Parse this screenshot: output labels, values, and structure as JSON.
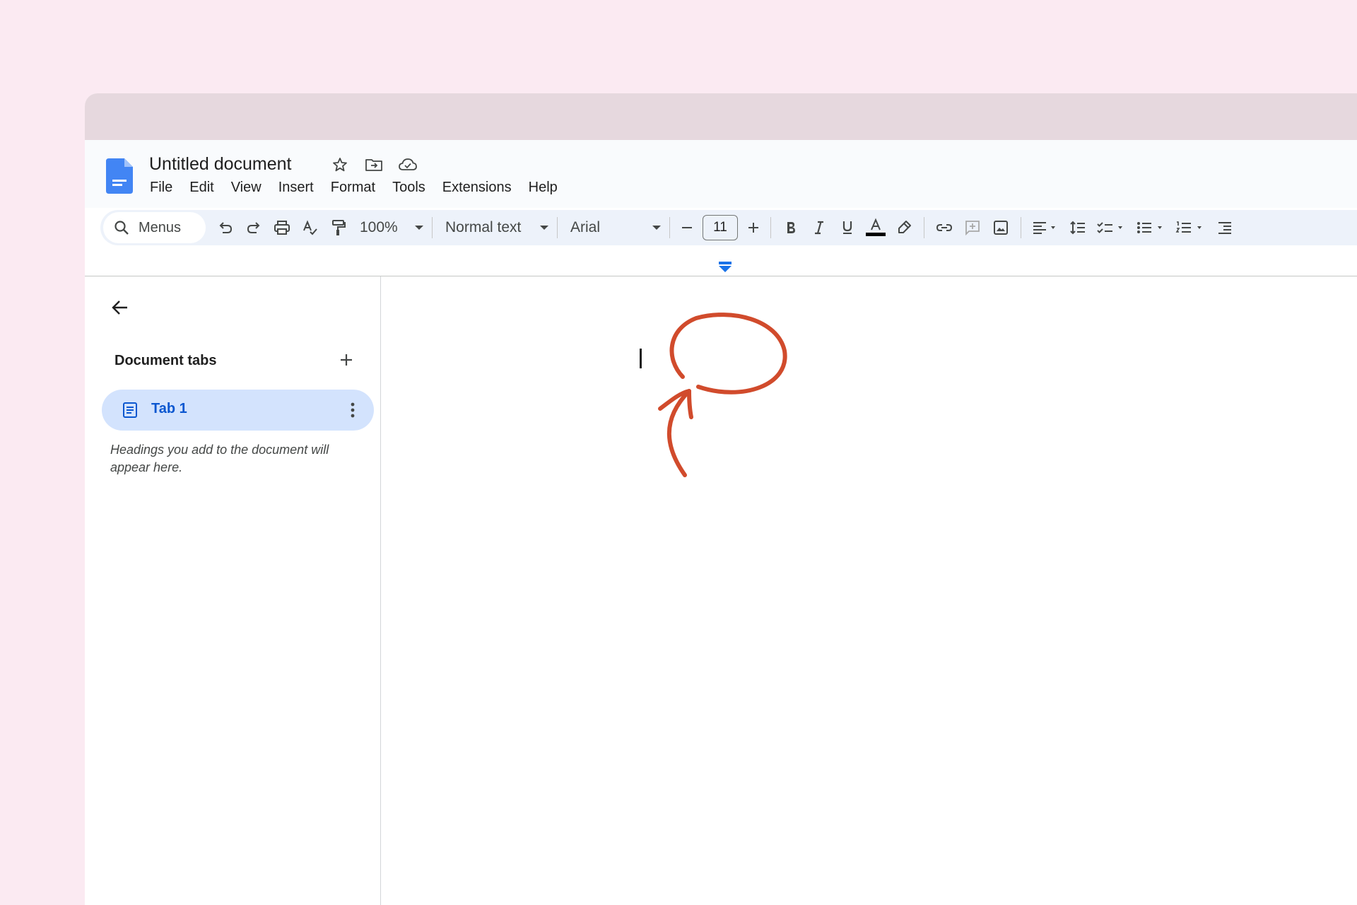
{
  "document": {
    "title": "Untitled document"
  },
  "menu": {
    "items": [
      "File",
      "Edit",
      "View",
      "Insert",
      "Format",
      "Tools",
      "Extensions",
      "Help"
    ]
  },
  "toolbar": {
    "search_label": "Menus",
    "zoom": "100%",
    "paragraph_style": "Normal text",
    "font": "Arial",
    "font_size": "11"
  },
  "sidebar": {
    "heading": "Document tabs",
    "tab_label": "Tab 1",
    "hint": "Headings you add to the document will appear here."
  },
  "colors": {
    "background": "#fbeaf2",
    "accent": "#1a73e8",
    "tab_highlight": "#d3e3fd",
    "annotation": "#d14b2c"
  },
  "icons": {
    "star": "star-icon",
    "move": "move-to-folder-icon",
    "cloud": "cloud-status-icon",
    "search": "search-icon",
    "undo": "undo-icon",
    "redo": "redo-icon",
    "print": "print-icon",
    "spellcheck": "spellcheck-icon",
    "paint_format": "paint-format-icon"
  }
}
